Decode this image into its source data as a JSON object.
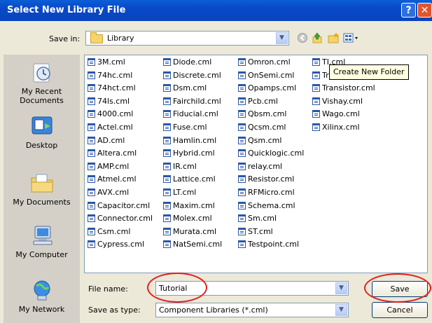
{
  "window": {
    "title": "Select New Library File"
  },
  "toolbar": {
    "save_in_label": "Save in:",
    "save_in_value": "Library",
    "tooltip": "Create New Folder"
  },
  "places": [
    {
      "label": "My Recent Documents",
      "icon": "recent-documents-icon"
    },
    {
      "label": "Desktop",
      "icon": "desktop-icon"
    },
    {
      "label": "My Documents",
      "icon": "my-documents-icon"
    },
    {
      "label": "My Computer",
      "icon": "my-computer-icon"
    },
    {
      "label": "My Network",
      "icon": "my-network-icon"
    }
  ],
  "files": {
    "col1": [
      "3M.cml",
      "74hc.cml",
      "74hct.cml",
      "74ls.cml",
      "4000.cml",
      "Actel.cml",
      "AD.cml",
      "Altera.cml",
      "AMP.cml",
      "Atmel.cml",
      "AVX.cml",
      "Capacitor.cml",
      "Connector.cml",
      "Csm.cml",
      "Cypress.cml"
    ],
    "col2": [
      "Diode.cml",
      "Discrete.cml",
      "Dsm.cml",
      "Fairchild.cml",
      "Fiducial.cml",
      "Fuse.cml",
      "Hamlin.cml",
      "Hybrid.cml",
      "IR.cml",
      "Lattice.cml",
      "LT.cml",
      "Maxim.cml",
      "Molex.cml",
      "Murata.cml",
      "NatSemi.cml"
    ],
    "col3": [
      "Omron.cml",
      "OnSemi.cml",
      "Opamps.cml",
      "Pcb.cml",
      "Qbsm.cml",
      "Qcsm.cml",
      "Qsm.cml",
      "Quicklogic.cml",
      "relay.cml",
      "Resistor.cml",
      "RFMicro.cml",
      "Schema.cml",
      "Sm.cml",
      "ST.cml",
      "Testpoint.cml"
    ],
    "col4": [
      "TI.cml",
      "Transformer.cml",
      "Transistor.cml",
      "Vishay.cml",
      "Wago.cml",
      "Xilinx.cml"
    ]
  },
  "form": {
    "filename_label": "File name:",
    "filename_value": "Tutorial",
    "savetype_label": "Save as type:",
    "savetype_value": "Component Libraries (*.cml)",
    "save_button": "Save",
    "cancel_button": "Cancel"
  },
  "colors": {
    "annotation": "#e02020",
    "titlebar": "#0848c9"
  }
}
